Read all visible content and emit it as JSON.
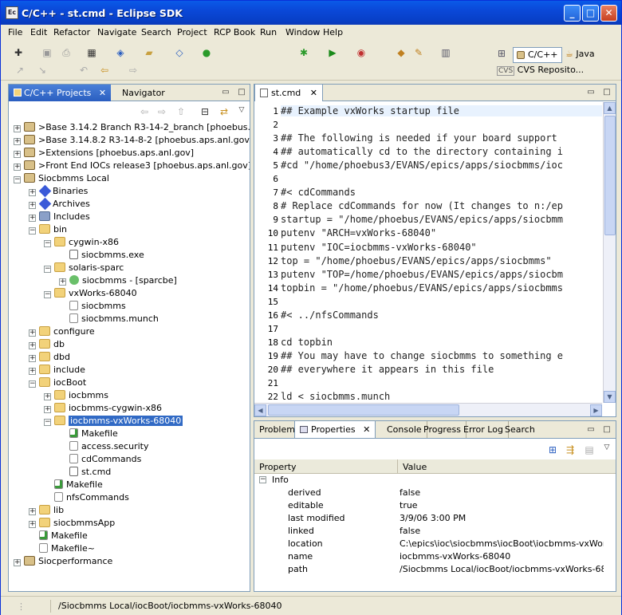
{
  "window": {
    "title": "C/C++ - st.cmd - Eclipse SDK",
    "app_icon": "Ec"
  },
  "title_buttons": {
    "minimize": "_",
    "maximize": "□",
    "close": "✕"
  },
  "menu": [
    "File",
    "Edit",
    "Refactor",
    "Navigate",
    "Search",
    "Project",
    "RCP Book",
    "Run",
    "Window",
    "Help"
  ],
  "perspectives": {
    "cpp": "C/C++",
    "java": "Java",
    "cvs": "CVS Reposito..."
  },
  "left_panel": {
    "tabs": {
      "projects": "C/C++ Projects",
      "navigator": "Navigator"
    },
    "tree": [
      {
        "label": ">Base 3.14.2 Branch  R3-14-2_branch [phoebus.aps.anl.gov]",
        "depth": 0,
        "exp": "+",
        "icon": "proj"
      },
      {
        "label": ">Base 3.14.8.2  R3-14-8-2 [phoebus.aps.anl.gov]",
        "depth": 0,
        "exp": "+",
        "icon": "proj"
      },
      {
        "label": ">Extensions  [phoebus.aps.anl.gov]",
        "depth": 0,
        "exp": "+",
        "icon": "proj"
      },
      {
        "label": ">Front End IOCs  release3 [phoebus.aps.anl.gov]",
        "depth": 0,
        "exp": "+",
        "icon": "proj"
      },
      {
        "label": "Siocbmms Local",
        "depth": 0,
        "exp": "-",
        "icon": "proj"
      },
      {
        "label": "Binaries",
        "depth": 1,
        "exp": "+",
        "icon": "bin"
      },
      {
        "label": "Archives",
        "depth": 1,
        "exp": "+",
        "icon": "bin"
      },
      {
        "label": "Includes",
        "depth": 1,
        "exp": "+",
        "icon": "inc"
      },
      {
        "label": "bin",
        "depth": 1,
        "exp": "-",
        "icon": "folder"
      },
      {
        "label": "cygwin-x86",
        "depth": 2,
        "exp": "-",
        "icon": "folder"
      },
      {
        "label": "siocbmms.exe",
        "depth": 3,
        "exp": "",
        "icon": "exe"
      },
      {
        "label": "solaris-sparc",
        "depth": 2,
        "exp": "-",
        "icon": "folder"
      },
      {
        "label": "siocbmms - [sparcbe]",
        "depth": 3,
        "exp": "+",
        "icon": "bug"
      },
      {
        "label": "vxWorks-68040",
        "depth": 2,
        "exp": "-",
        "icon": "folder"
      },
      {
        "label": "siocbmms",
        "depth": 3,
        "exp": "",
        "icon": "file"
      },
      {
        "label": "siocbmms.munch",
        "depth": 3,
        "exp": "",
        "icon": "file"
      },
      {
        "label": "configure",
        "depth": 1,
        "exp": "+",
        "icon": "folder"
      },
      {
        "label": "db",
        "depth": 1,
        "exp": "+",
        "icon": "folder"
      },
      {
        "label": "dbd",
        "depth": 1,
        "exp": "+",
        "icon": "folder"
      },
      {
        "label": "include",
        "depth": 1,
        "exp": "+",
        "icon": "folder"
      },
      {
        "label": "iocBoot",
        "depth": 1,
        "exp": "-",
        "icon": "folder"
      },
      {
        "label": "iocbmms",
        "depth": 2,
        "exp": "+",
        "icon": "folder"
      },
      {
        "label": "iocbmms-cygwin-x86",
        "depth": 2,
        "exp": "+",
        "icon": "folder"
      },
      {
        "label": "iocbmms-vxWorks-68040",
        "depth": 2,
        "exp": "-",
        "icon": "folder",
        "selected": true
      },
      {
        "label": "Makefile",
        "depth": 3,
        "exp": "",
        "icon": "make"
      },
      {
        "label": "access.security",
        "depth": 3,
        "exp": "",
        "icon": "file"
      },
      {
        "label": "cdCommands",
        "depth": 3,
        "exp": "",
        "icon": "file"
      },
      {
        "label": "st.cmd",
        "depth": 3,
        "exp": "",
        "icon": "exe"
      },
      {
        "label": "Makefile",
        "depth": 2,
        "exp": "",
        "icon": "make"
      },
      {
        "label": "nfsCommands",
        "depth": 2,
        "exp": "",
        "icon": "file"
      },
      {
        "label": "lib",
        "depth": 1,
        "exp": "+",
        "icon": "folder"
      },
      {
        "label": "siocbmmsApp",
        "depth": 1,
        "exp": "+",
        "icon": "folder"
      },
      {
        "label": "Makefile",
        "depth": 1,
        "exp": "",
        "icon": "make"
      },
      {
        "label": "Makefile~",
        "depth": 1,
        "exp": "",
        "icon": "file"
      },
      {
        "label": "Siocperformance",
        "depth": 0,
        "exp": "+",
        "icon": "proj"
      }
    ]
  },
  "editor": {
    "tab": "st.cmd",
    "lines": [
      {
        "n": "1",
        "t": "## Example vxWorks startup file"
      },
      {
        "n": "2",
        "t": ""
      },
      {
        "n": "3",
        "t": "## The following is needed if your board support"
      },
      {
        "n": "4",
        "t": "## automatically cd to the directory containing i"
      },
      {
        "n": "5",
        "t": "#cd \"/home/phoebus3/EVANS/epics/apps/siocbmms/ioc"
      },
      {
        "n": "6",
        "t": ""
      },
      {
        "n": "7",
        "t": "#< cdCommands"
      },
      {
        "n": "8",
        "t": "# Replace cdCommands for now (It changes to n:/ep"
      },
      {
        "n": "9",
        "t": "startup = \"/home/phoebus/EVANS/epics/apps/siocbmm"
      },
      {
        "n": "10",
        "t": "putenv \"ARCH=vxWorks-68040\""
      },
      {
        "n": "11",
        "t": "putenv \"IOC=iocbmms-vxWorks-68040\""
      },
      {
        "n": "12",
        "t": "top = \"/home/phoebus/EVANS/epics/apps/siocbmms\""
      },
      {
        "n": "13",
        "t": "putenv \"TOP=/home/phoebus/EVANS/epics/apps/siocbm"
      },
      {
        "n": "14",
        "t": "topbin = \"/home/phoebus/EVANS/epics/apps/siocbmms"
      },
      {
        "n": "15",
        "t": ""
      },
      {
        "n": "16",
        "t": "#< ../nfsCommands"
      },
      {
        "n": "17",
        "t": ""
      },
      {
        "n": "18",
        "t": "cd topbin"
      },
      {
        "n": "19",
        "t": "## You may have to change siocbmms to something e"
      },
      {
        "n": "20",
        "t": "## everywhere it appears in this file"
      },
      {
        "n": "21",
        "t": ""
      },
      {
        "n": "22",
        "t": "ld < siocbmms.munch"
      }
    ]
  },
  "bottom_panel": {
    "tabs": {
      "problems": "Problems",
      "properties": "Properties",
      "console": "Console",
      "progress": "Progress",
      "errorlog": "Error Log",
      "search": "Search"
    },
    "columns": {
      "property": "Property",
      "value": "Value"
    },
    "group": "Info",
    "rows": [
      {
        "k": "derived",
        "v": "false"
      },
      {
        "k": "editable",
        "v": "true"
      },
      {
        "k": "last modified",
        "v": "3/9/06 3:00 PM"
      },
      {
        "k": "linked",
        "v": "false"
      },
      {
        "k": "location",
        "v": "C:\\epics\\ioc\\siocbmms\\iocBoot\\iocbmms-vxWorks-6..."
      },
      {
        "k": "name",
        "v": "iocbmms-vxWorks-68040"
      },
      {
        "k": "path",
        "v": "/Siocbmms Local/iocBoot/iocbmms-vxWorks-68040"
      }
    ]
  },
  "status": {
    "path": "/Siocbmms Local/iocBoot/iocbmms-vxWorks-68040"
  },
  "colors": {
    "selection": "#316ac5",
    "titlebar": "#0a48d8",
    "current_line": "#e8f2fe"
  }
}
